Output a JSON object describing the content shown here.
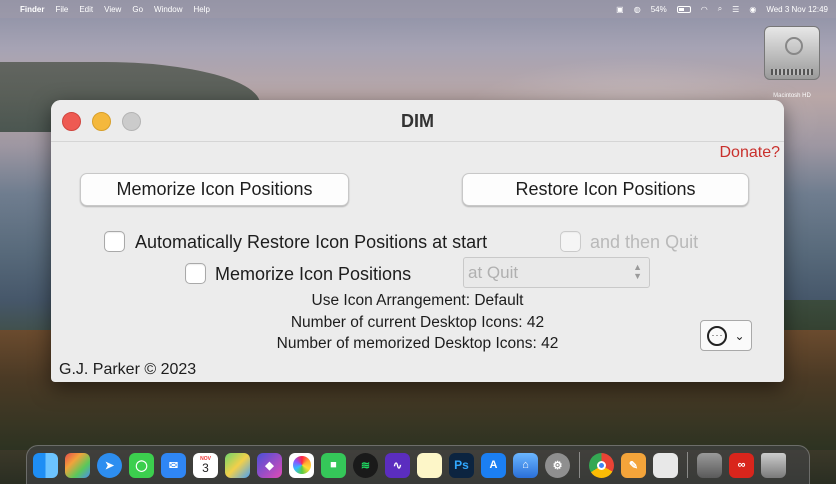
{
  "menubar": {
    "items": [
      "Finder",
      "File",
      "Edit",
      "View",
      "Go",
      "Window",
      "Help"
    ],
    "battery_percent": "54%",
    "battery_level": 0.54,
    "datetime": "Wed 3 Nov  12:49"
  },
  "desktop": {
    "disk_label": "Macintosh HD"
  },
  "window": {
    "title": "DIM",
    "donate_label": "Donate?",
    "memorize_button": "Memorize Icon Positions",
    "restore_button": "Restore Icon Positions",
    "auto_restore_label": "Automatically Restore Icon Positions at start",
    "then_quit_label": "and then Quit",
    "memorize_checkbox_label": "Memorize Icon Positions",
    "quit_select_value": "at Quit",
    "arrangement_text": "Use Icon Arrangement: Default",
    "current_icons_text": "Number of current Desktop Icons: 42",
    "memorized_icons_text": "Number of memorized Desktop Icons: 42",
    "copyright": "G.J. Parker © 2023"
  },
  "dock": {
    "calendar_day": "3",
    "calendar_month": "NOV",
    "photoshop_label": "Ps"
  },
  "colors": {
    "close": "#ee5a52",
    "minimize": "#f4b83c",
    "donate": "#c9302c"
  }
}
